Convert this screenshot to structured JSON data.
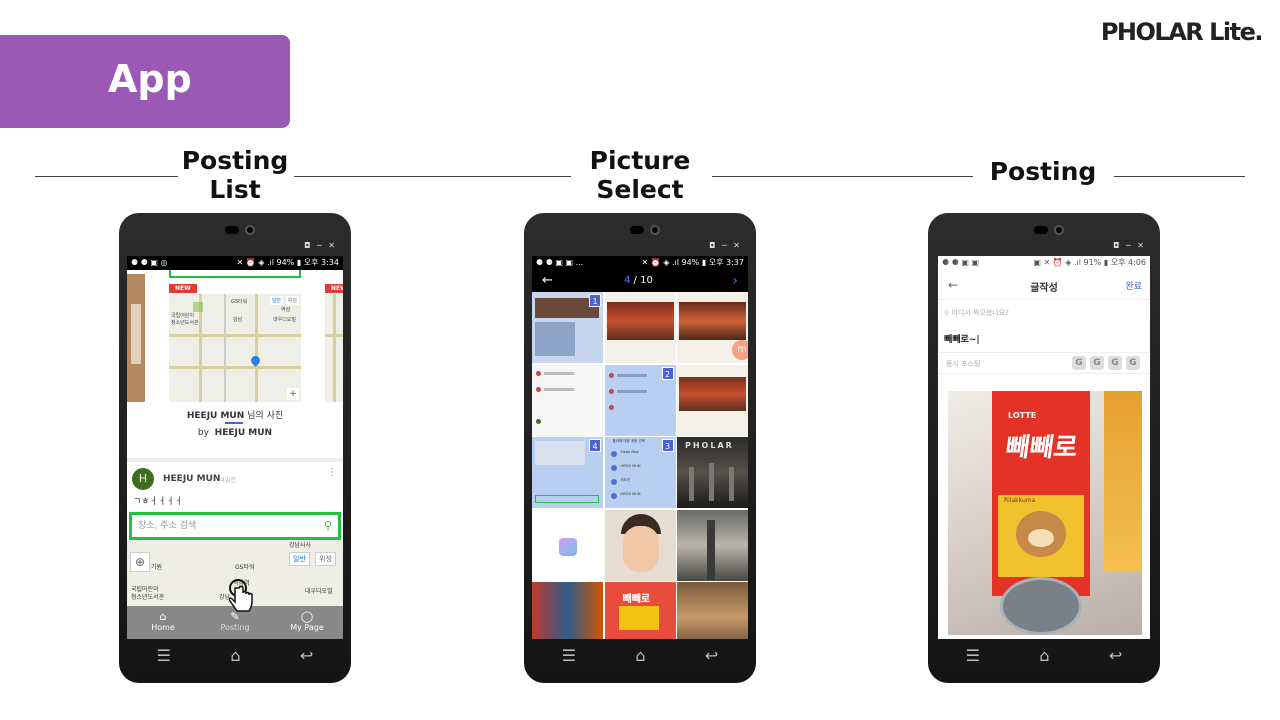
{
  "brand": "PHOLAR Lite.",
  "banner": "App",
  "sections": [
    {
      "title_line1": "Posting",
      "title_line2": "List"
    },
    {
      "title_line1": "Picture",
      "title_line2": "Select"
    },
    {
      "title_line1": "Posting",
      "title_line2": ""
    }
  ],
  "window_controls": "◘ ─ ✕",
  "navbar": {
    "menu": "☰",
    "home": "⌂",
    "back": "↩"
  },
  "screen1": {
    "status_left": "⚈ ⚈ ▣ ◎",
    "status_right": "✕ ⏰ ◈ .ıl 94% ▮ 오후 3:34",
    "new_badge": "NEW",
    "map_labels": [
      "GS타워",
      "역삼",
      "국립어린이",
      "청소년도서관",
      "강남",
      "대우디오빌",
      "일반",
      "위성"
    ],
    "card_title_user": "HEEJU MUN",
    "card_title_suffix": " 님의 사진",
    "card_by_prefix": "by",
    "card_by_user": "HEEJU MUN",
    "post_avatar": "H",
    "post_user": "HEEJU MUN",
    "post_time": "4일전",
    "post_text": "ㄱㅎㅓㅓㅓㅓ",
    "search_placeholder": "장소, 주소 검색",
    "big_map_labels": [
      "강남사사",
      "기원",
      "GS타워",
      "역삼역",
      "국립어린이",
      "청소년도서관",
      "강남",
      "대우디오빌",
      "일반",
      "위성"
    ],
    "tabs": [
      {
        "label": "Home"
      },
      {
        "label": "Posting"
      },
      {
        "label": "My Page"
      }
    ]
  },
  "screen2": {
    "status_left": "⚈ ⚈ ▣ ▣ ...",
    "status_right": "✕ ⏰ ◈ .ıl 94% ▮ 오후 3:37",
    "counter_current": "4",
    "counter_total": " / 10",
    "back": "←",
    "next": "›",
    "numbers": [
      "1",
      "2",
      "4",
      "3"
    ],
    "pholar_text": "PHOLAR",
    "list_item_1": "Sleep Moo",
    "list_item_2": "HEEJU MUN",
    "list_item_3": "최도진",
    "list_item_4": "HEEJU MUN",
    "list_header": "플라에 대한 계정 선택",
    "snack_label": "빼빼로"
  },
  "screen3": {
    "status_left": "⚈ ⚈ ▣ ▣",
    "status_right": "▣ ✕ ⏰ ◈ .ıl 91% ▮ 오후 4:06",
    "back": "←",
    "title": "글작성",
    "done": "완료",
    "location_placeholder": "어디서 찍으셨나요?",
    "post_text": "빼빼로~|",
    "share_label": "동시 포스팅",
    "share_icons": [
      "G",
      "G",
      "G",
      "G"
    ],
    "photo_brand": "LOTTE",
    "photo_product": "빼빼로",
    "photo_sub": "Rilakkuma"
  },
  "colors": {
    "banner": "#9b59b6",
    "accent_green": "#22c03c",
    "select_blue": "#4a63d9",
    "done_blue": "#3366cc"
  }
}
